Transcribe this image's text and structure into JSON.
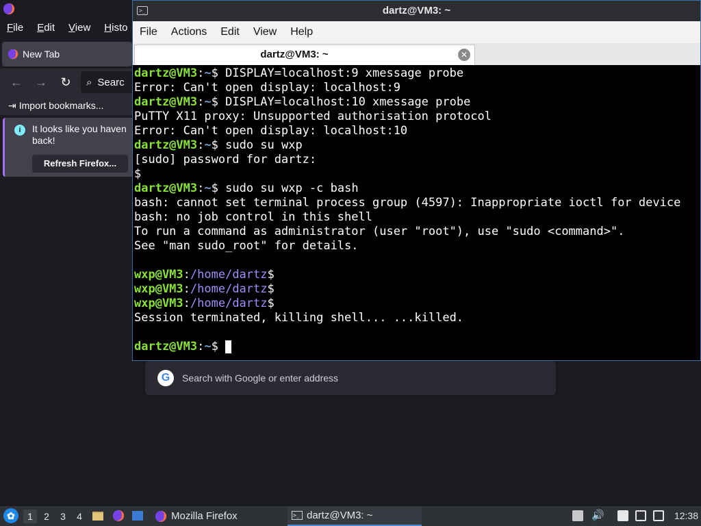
{
  "firefox": {
    "menus": [
      "File",
      "Edit",
      "View",
      "Histo"
    ],
    "tab_title": "New Tab",
    "search_partial": "Searc",
    "bookmark_import": "Import bookmarks...",
    "notice_text_1": "It looks like you haven",
    "notice_text_2": "back!",
    "refresh_button": "Refresh Firefox...",
    "urlbar_placeholder": "Search with Google or enter address"
  },
  "terminal": {
    "window_title": "dartz@VM3: ~",
    "menus": [
      "File",
      "Actions",
      "Edit",
      "View",
      "Help"
    ],
    "tab_label": "dartz@VM3: ~",
    "lines": [
      {
        "user": "dartz@VM3",
        "path": "~",
        "sym": "$ ",
        "cmd": "DISPLAY=localhost:9 xmessage probe"
      },
      {
        "text": "Error: Can't open display: localhost:9"
      },
      {
        "user": "dartz@VM3",
        "path": "~",
        "sym": "$ ",
        "cmd": "DISPLAY=localhost:10 xmessage probe"
      },
      {
        "text": "PuTTY X11 proxy: Unsupported authorisation protocol"
      },
      {
        "text": "Error: Can't open display: localhost:10"
      },
      {
        "user": "dartz@VM3",
        "path": "~",
        "sym": "$ ",
        "cmd": "sudo su wxp"
      },
      {
        "text": "[sudo] password for dartz:"
      },
      {
        "text": "$"
      },
      {
        "user": "dartz@VM3",
        "path": "~",
        "sym": "$ ",
        "cmd": "sudo su wxp -c bash"
      },
      {
        "text": "bash: cannot set terminal process group (4597): Inappropriate ioctl for device"
      },
      {
        "text": "bash: no job control in this shell"
      },
      {
        "text": "To run a command as administrator (user \"root\"), use \"sudo <command>\"."
      },
      {
        "text": "See \"man sudo_root\" for details."
      },
      {
        "text": ""
      },
      {
        "user": "wxp@VM3",
        "path": "/home/dartz",
        "sym": "$",
        "cmd": ""
      },
      {
        "user": "wxp@VM3",
        "path": "/home/dartz",
        "sym": "$",
        "cmd": ""
      },
      {
        "user": "wxp@VM3",
        "path": "/home/dartz",
        "sym": "$",
        "cmd": ""
      },
      {
        "text": "Session terminated, killing shell... ...killed."
      },
      {
        "text": ""
      },
      {
        "user": "dartz@VM3",
        "path": "~",
        "sym": "$ ",
        "cmd": "",
        "cursor": true
      }
    ]
  },
  "taskbar": {
    "workspaces": [
      "1",
      "2",
      "3",
      "4"
    ],
    "tasks": [
      {
        "label": "Mozilla Firefox",
        "icon": "firefox-icon"
      },
      {
        "label": "dartz@VM3: ~",
        "icon": "terminal-icon"
      }
    ],
    "clock": "12:38"
  }
}
